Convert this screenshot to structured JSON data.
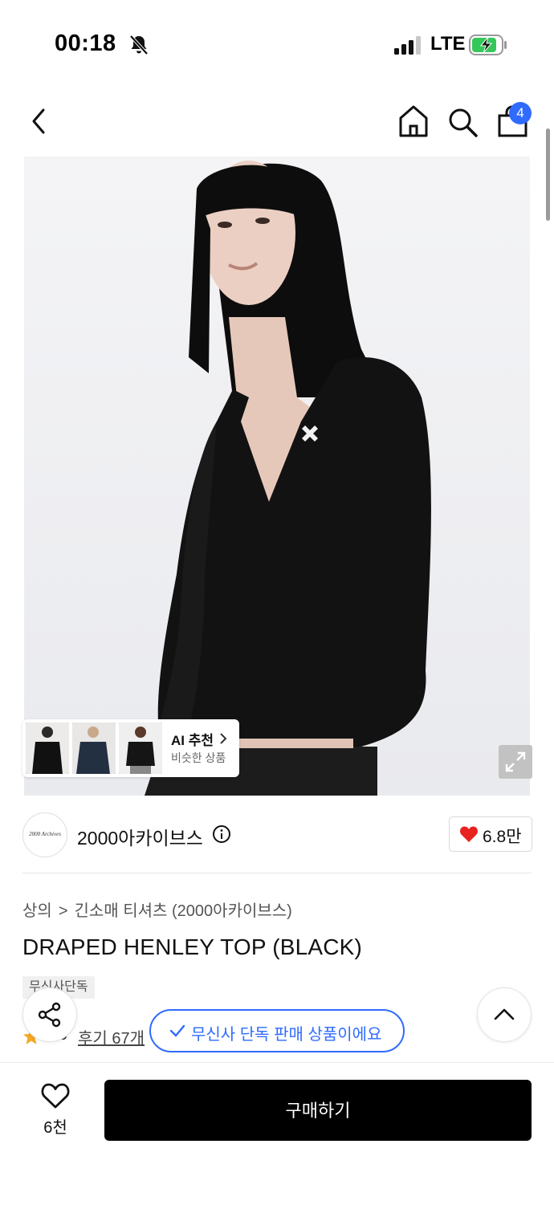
{
  "status_bar": {
    "time": "00:18",
    "network": "LTE",
    "icons": [
      "bell-off-icon",
      "signal-icon",
      "battery-charging-icon"
    ]
  },
  "header": {
    "icons": [
      "chevron-left-icon",
      "home-icon",
      "search-icon",
      "shopping-bag-icon"
    ],
    "cart_badge": "4"
  },
  "ai_recommend": {
    "title": "AI 추천",
    "subtitle": "비슷한 상품",
    "icon": "chevron-right-icon"
  },
  "brand": {
    "logo_text": "2000 Archives",
    "name": "2000아카이브스",
    "likes": "6.8만",
    "heart_color": "#e8231f"
  },
  "breadcrumb": {
    "level1": "상의",
    "level2": "긴소매 티셔츠 (2000아카이브스)"
  },
  "product": {
    "title": "DRAPED HENLEY TOP (BLACK)",
    "tag": "무신사단독",
    "rating": "4.8",
    "reviews": "후기 67개"
  },
  "toast": {
    "text": "무신사 단독 판매 상품이에요",
    "color": "#2f6bff"
  },
  "bottom": {
    "wish_count": "6천",
    "buy_label": "구매하기"
  }
}
